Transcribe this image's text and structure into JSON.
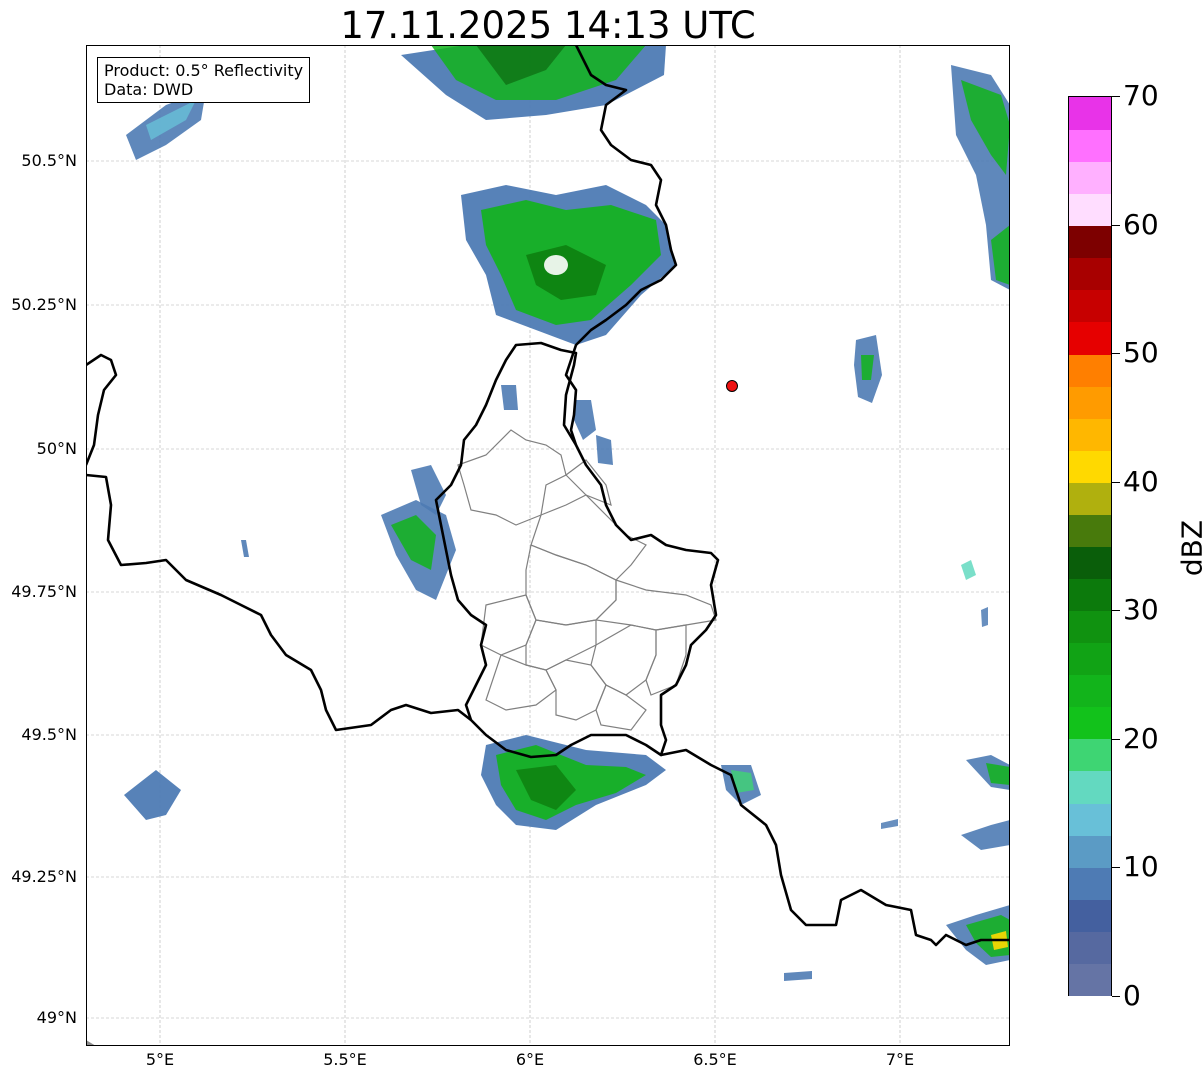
{
  "title": "17.11.2025 14:13 UTC",
  "info": {
    "line1": "Product: 0.5° Reflectivity",
    "line2": "Data: DWD"
  },
  "map": {
    "lat_labels": [
      "50.5°N",
      "50.25°N",
      "50°N",
      "49.75°N",
      "49.5°N",
      "49.25°N",
      "49°N"
    ],
    "lon_labels": [
      "5°E",
      "5.5°E",
      "6°E",
      "6.5°E",
      "7°E"
    ],
    "lon_range": [
      4.8,
      7.3
    ],
    "lat_range": [
      48.95,
      50.7
    ],
    "site_marker": {
      "lon": 6.55,
      "lat": 50.11,
      "color": "#ee1111"
    },
    "border_color": "#000000",
    "district_color": "#808080",
    "grid": true
  },
  "colorbar": {
    "label": "dBZ",
    "min": 0,
    "max": 70,
    "ticks": [
      "0",
      "10",
      "20",
      "30",
      "40",
      "50",
      "60",
      "70"
    ],
    "colors": [
      "#6574a5",
      "#5669a0",
      "#44609f",
      "#4e7bb4",
      "#5b9bc5",
      "#68c0d8",
      "#63d9c0",
      "#3ed573",
      "#12c21b",
      "#12b41b",
      "#11a315",
      "#109210",
      "#0c7a0c",
      "#0a5e0a",
      "#487a0c",
      "#b0b00e",
      "#ffd900",
      "#ffb700",
      "#ff9b00",
      "#ff7f00",
      "#e60000",
      "#c70000",
      "#a80000",
      "#7d0000",
      "#ffddff",
      "#ffb0ff",
      "#ff70ff",
      "#e833e8"
    ]
  }
}
